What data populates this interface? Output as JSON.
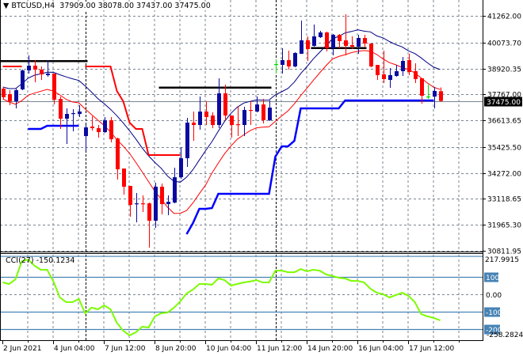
{
  "header": {
    "symbol": "BTCUSD,H4",
    "open": "37909.00",
    "high": "38078.00",
    "low": "37437.00",
    "close": "37475.00"
  },
  "colors": {
    "bull": "#0a0aa0",
    "bear": "#ff0000",
    "doji": "#00dd00",
    "ma_upper": "#000080",
    "ma_lower": "#ff0000",
    "trail_red": "#ff0000",
    "trail_blue": "#0000ff",
    "cci": "#7cfc00",
    "cci_levels": "#4682b4"
  },
  "chart_data": [
    {
      "type": "candlestick",
      "title": "BTCUSD,H4",
      "ylim": [
        30811.95,
        41262.0
      ],
      "price_ticks": [
        "41262.00",
        "40073.70",
        "38920.35",
        "37767.00",
        "36613.65",
        "35425.50",
        "34272.00",
        "33118.65",
        "31965.30",
        "30811.95"
      ],
      "price_tick_values": [
        41262.0,
        40073.7,
        38920.35,
        37767.0,
        36613.65,
        35425.5,
        34272.0,
        33118.65,
        31965.3,
        30811.95
      ],
      "current_price_label": "37475.00",
      "current_price": 37475.0,
      "x_labels": [
        "2 Jun 2021",
        "4 Jun 04:00",
        "7 Jun 12:00",
        "8 Jun 20:00",
        "10 Jun 04:00",
        "11 Jun 12:00",
        "14 Jun 20:00",
        "16 Jun 04:00",
        "17 Jun 12:00"
      ],
      "x_label_bar_index": [
        0,
        8,
        16,
        24,
        32,
        40,
        48,
        56,
        64
      ],
      "period_separator_bar_index": [
        13,
        43
      ],
      "ohlc": [
        [
          38025,
          38095,
          37567,
          37638
        ],
        [
          37778,
          37954,
          37286,
          37462
        ],
        [
          37462,
          38025,
          37145,
          37954
        ],
        [
          37990,
          38869,
          37954,
          38834
        ],
        [
          38834,
          39503,
          38693,
          39045
        ],
        [
          39045,
          39292,
          38306,
          38869
        ],
        [
          38869,
          39010,
          38412,
          38658
        ],
        [
          38623,
          39292,
          38553,
          38693
        ],
        [
          38693,
          38693,
          37321,
          37532
        ],
        [
          37567,
          37673,
          36230,
          36687
        ],
        [
          36687,
          37145,
          35561,
          36899
        ],
        [
          36899,
          37110,
          36124,
          36934
        ],
        [
          36899,
          37286,
          36758,
          37004
        ],
        [
          35913,
          36406,
          35245,
          36300
        ],
        [
          36336,
          36793,
          36160,
          36265
        ],
        [
          36265,
          36406,
          35843,
          36089
        ],
        [
          36089,
          36758,
          36054,
          36617
        ],
        [
          36617,
          36758,
          35632,
          35773
        ],
        [
          35808,
          35843,
          33978,
          34435
        ],
        [
          34471,
          34471,
          33309,
          33661
        ],
        [
          33696,
          33696,
          32324,
          32852
        ],
        [
          32887,
          33380,
          32078,
          32922
        ],
        [
          32922,
          33274,
          32535,
          32887
        ],
        [
          32922,
          32957,
          30952,
          32148
        ],
        [
          32148,
          33837,
          31831,
          33661
        ],
        [
          33661,
          33802,
          32430,
          32887
        ],
        [
          32887,
          33274,
          32394,
          32993
        ],
        [
          32957,
          34506,
          32922,
          34083
        ],
        [
          34083,
          35421,
          34013,
          34928
        ],
        [
          34928,
          36723,
          34541,
          36512
        ],
        [
          36512,
          37004,
          35702,
          36406
        ],
        [
          36406,
          37673,
          36195,
          37004
        ],
        [
          37004,
          37462,
          36406,
          36758
        ],
        [
          36828,
          36969,
          36265,
          36406
        ],
        [
          36406,
          38482,
          36265,
          37814
        ],
        [
          37814,
          38201,
          36617,
          36828
        ],
        [
          36828,
          36828,
          35843,
          36406
        ],
        [
          36441,
          37251,
          35913,
          36406
        ],
        [
          36406,
          37215,
          35913,
          37075
        ],
        [
          37075,
          37462,
          36406,
          37039
        ],
        [
          37004,
          37673,
          36969,
          37321
        ],
        [
          37321,
          37567,
          36476,
          36617
        ],
        [
          36617,
          37497,
          36582,
          37180
        ],
        [
          39116,
          39327,
          38693,
          39116
        ],
        [
          39080,
          39819,
          38693,
          39292
        ],
        [
          39292,
          39714,
          38869,
          39010
        ],
        [
          39010,
          39643,
          38975,
          39608
        ],
        [
          39573,
          41051,
          39573,
          40171
        ],
        [
          40171,
          40347,
          39256,
          39784
        ],
        [
          39925,
          40875,
          39890,
          40347
        ],
        [
          40312,
          40594,
          40277,
          40523
        ],
        [
          40523,
          40558,
          39679,
          39819
        ],
        [
          39819,
          40453,
          39503,
          40418
        ],
        [
          40418,
          40453,
          39819,
          40136
        ],
        [
          40171,
          41333,
          39503,
          39925
        ],
        [
          39960,
          40347,
          39784,
          39890
        ],
        [
          39890,
          40418,
          39573,
          40277
        ],
        [
          40277,
          40418,
          39890,
          40031
        ],
        [
          40031,
          40031,
          38975,
          39010
        ],
        [
          39080,
          39080,
          38412,
          38623
        ],
        [
          38658,
          39714,
          38271,
          38447
        ],
        [
          38412,
          38940,
          38060,
          38623
        ],
        [
          38588,
          39080,
          38553,
          38799
        ],
        [
          38799,
          39432,
          38588,
          39256
        ],
        [
          39292,
          39573,
          38623,
          38764
        ],
        [
          38799,
          39151,
          38271,
          38447
        ],
        [
          38482,
          38482,
          37356,
          37708
        ],
        [
          37673,
          38201,
          37567,
          37673
        ],
        [
          37673,
          38095,
          37145,
          37919
        ],
        [
          37909,
          38078,
          37437,
          37475
        ]
      ],
      "trail_red": [
        39010,
        39010,
        39010,
        39010,
        null,
        null,
        null,
        null,
        null,
        null,
        null,
        null,
        null,
        39010,
        39010,
        39010,
        39010,
        39010,
        37919,
        37462,
        36512,
        36230,
        36230,
        35069,
        35069,
        35069,
        35069,
        35069,
        35069
      ],
      "trail_blue_start": 4,
      "trail_blue": [
        36230,
        36230,
        36230,
        36371,
        36371,
        36371,
        36371,
        36371,
        36371,
        null,
        null,
        null,
        null,
        null,
        null,
        null,
        null,
        null,
        null,
        null,
        null,
        null,
        null,
        null,
        null,
        31550,
        32042,
        32676,
        32676,
        32711,
        33345,
        33345,
        33345,
        33345,
        33345,
        33345,
        33345,
        33345,
        33345,
        34998,
        35456,
        35456,
        35702,
        37145,
        37145,
        37145,
        37145,
        37145,
        37145,
        37145,
        37497,
        37497,
        37497,
        37497,
        37497,
        37497,
        37497,
        37497,
        37497,
        37497,
        37497,
        37497,
        37497,
        37497,
        37497
      ],
      "levels": [
        {
          "price": 39246,
          "from_bar": 0,
          "to_bar": 13
        },
        {
          "price": 38070,
          "from_bar": 25,
          "to_bar": 42
        },
        {
          "price": 39830,
          "from_bar": 49,
          "to_bar": 57
        }
      ]
    },
    {
      "type": "line",
      "title": "CCI(27)",
      "value_label": "-150.1234",
      "ylim": [
        -258.2824,
        217.9915
      ],
      "max_label": "217.9915",
      "min_label": "-258.2824",
      "level_labels": [
        "100",
        "0.00",
        "-100",
        "-200"
      ],
      "levels": [
        100,
        0,
        -100,
        -200
      ],
      "values": [
        68,
        59,
        86,
        190,
        200,
        164,
        141,
        141,
        73,
        -18,
        -45,
        -45,
        -27,
        -109,
        -77,
        -86,
        -64,
        -86,
        -164,
        -209,
        -236,
        -218,
        -186,
        -191,
        -127,
        -109,
        -105,
        -77,
        -41,
        5,
        27,
        59,
        59,
        55,
        91,
        82,
        50,
        59,
        68,
        73,
        82,
        68,
        68,
        136,
        136,
        127,
        127,
        145,
        132,
        141,
        136,
        114,
        105,
        95,
        91,
        77,
        77,
        68,
        32,
        9,
        0,
        -18,
        -5,
        9,
        -9,
        -45,
        -114,
        -127,
        -136,
        -150
      ]
    }
  ]
}
